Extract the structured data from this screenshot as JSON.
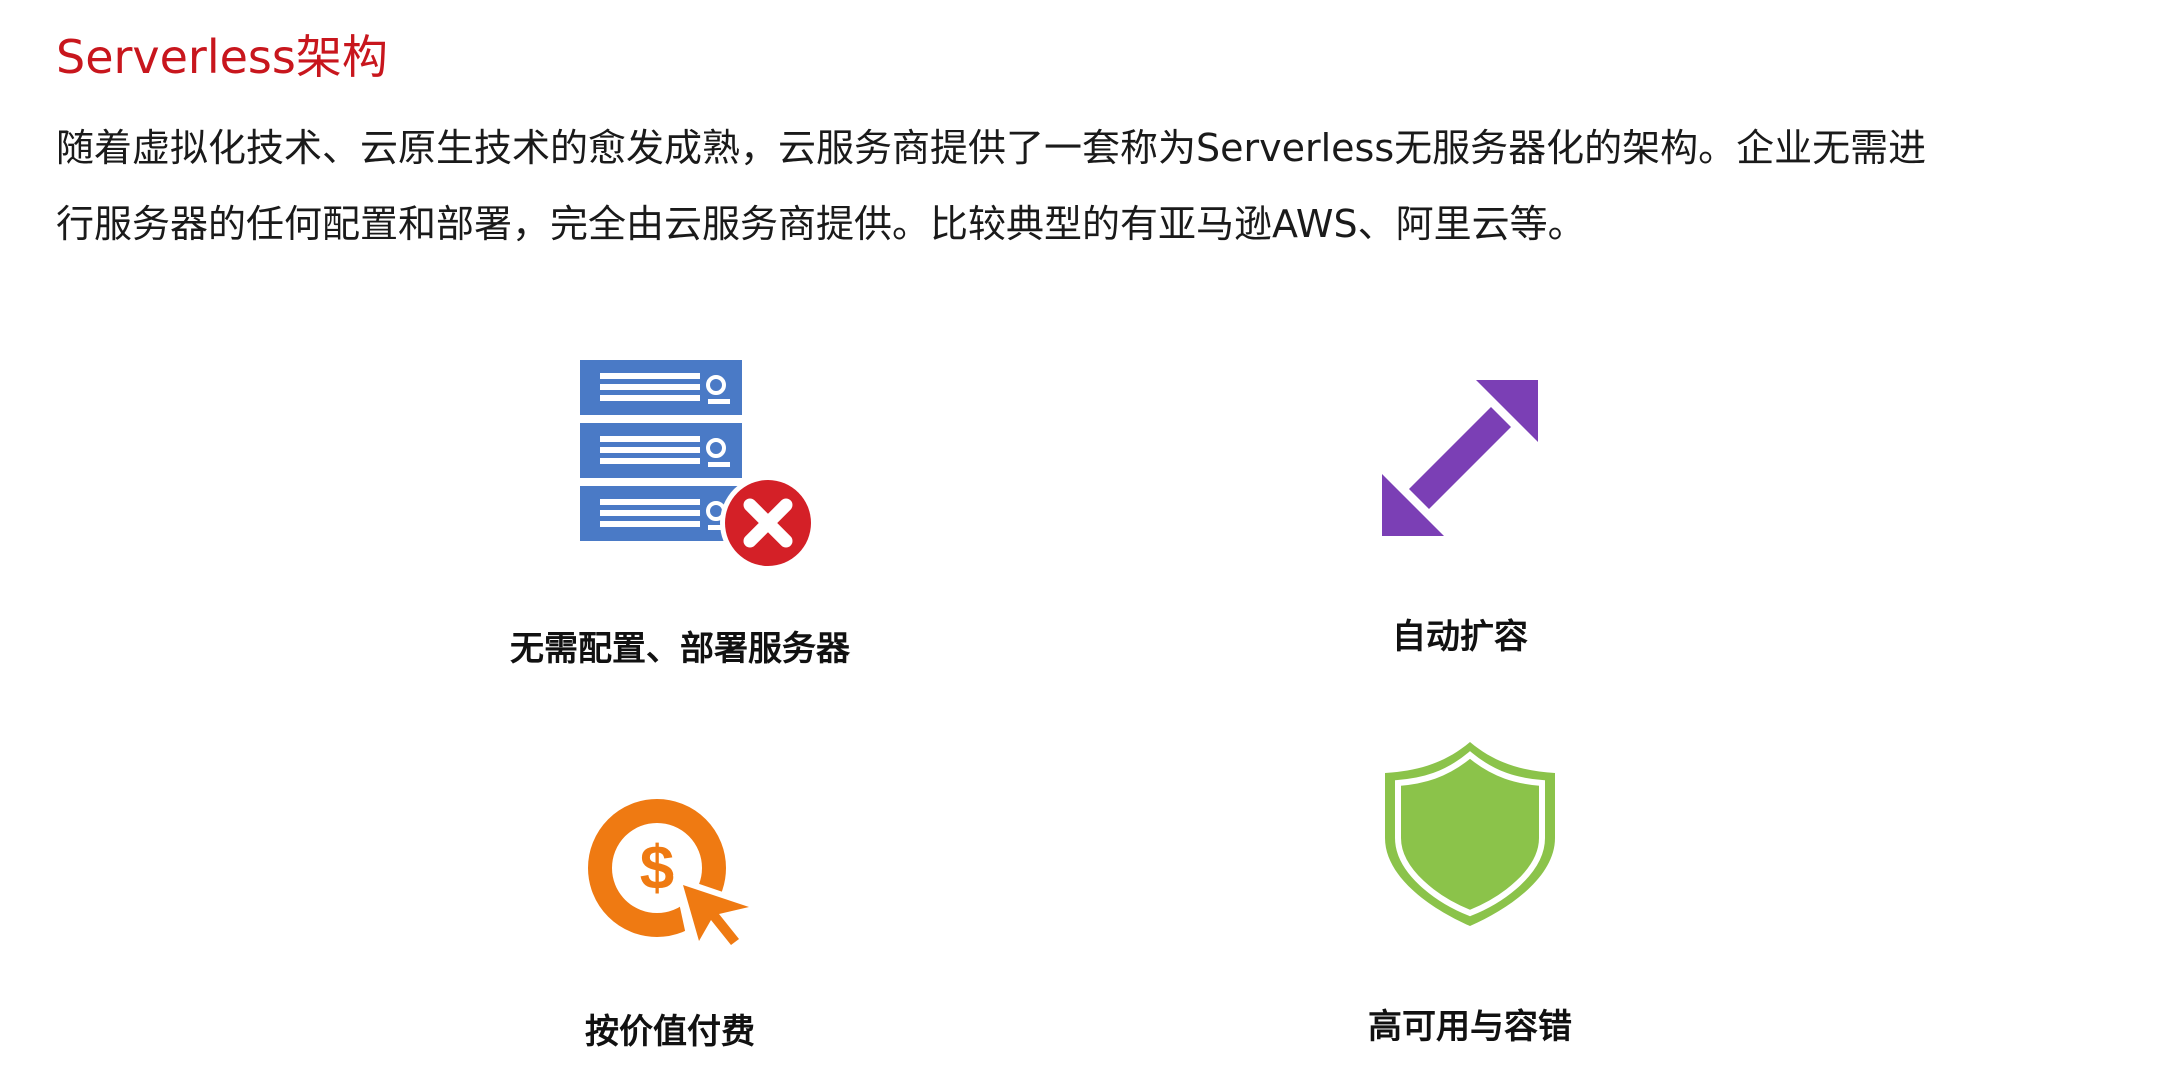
{
  "title": "Serverless架构",
  "intro": {
    "line1": "随着虚拟化技术、云原生技术的愈发成熟，云服务商提供了一套称为Serverless无服务器化的架构。企业无需进",
    "line2": "行服务器的任何配置和部署，完全由云服务商提供。比较典型的有亚马逊AWS、阿里云等。"
  },
  "features": [
    {
      "label": "无需配置、部署服务器",
      "icon": "server-stack-error-icon"
    },
    {
      "label": "自动扩容",
      "icon": "expand-arrows-icon"
    },
    {
      "label": "按价值付费",
      "icon": "dollar-click-icon"
    },
    {
      "label": "高可用与容错",
      "icon": "shield-icon"
    }
  ],
  "colors": {
    "title": "#c8161d",
    "server": "#4a7ac6",
    "error": "#d42027",
    "arrow": "#7b3fb5",
    "payment": "#ef7a12",
    "shield": "#8bc34a"
  }
}
